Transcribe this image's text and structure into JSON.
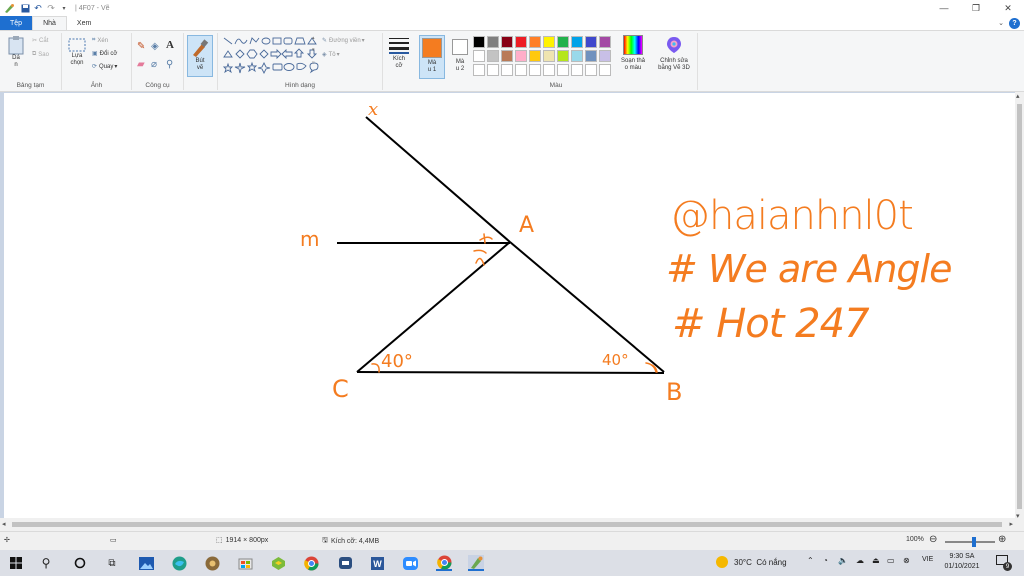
{
  "title_bar": {
    "title": "| 4F07 - Vẽ",
    "controls": [
      "—",
      "❐",
      "✕"
    ]
  },
  "tabs": [
    {
      "label": "Tệp"
    },
    {
      "label": "Nhà"
    },
    {
      "label": "Xem"
    }
  ],
  "ribbon": {
    "clipboard": {
      "paste_label": "Dá\nn",
      "cut_label": "Cắt",
      "copy_label": "Sao",
      "group_label": "Bảng tạm"
    },
    "image": {
      "select_label": "Lựa\nchọn",
      "crop_label": "Xén",
      "resize_label": "Đổi cỡ",
      "rotate_label": "Quay",
      "group_label": "Ảnh"
    },
    "tools": {
      "group_label": "Công cụ"
    },
    "brushes": {
      "label": "Bút\nvẽ"
    },
    "shapes": {
      "outline_label": "Đường viền",
      "fill_label": "Tô",
      "group_label": "Hình dạng"
    },
    "size": {
      "label": "Kích\ncỡ"
    },
    "colors": {
      "color1_label": "Mà\nu 1",
      "color2_label": "Mà\nu 2",
      "edit_label": "Soạn thả\no màu",
      "paint3d_label": "Chỉnh sửa\nbằng Vẽ 3D",
      "group_label": "Màu",
      "color1": "#f47c20",
      "color2": "#ffffff",
      "palette_row1": [
        "#000000",
        "#7f7f7f",
        "#880015",
        "#ed1c24",
        "#ff7f27",
        "#fff200",
        "#22b14c",
        "#00a2e8",
        "#3f48cc",
        "#a349a4"
      ],
      "palette_row2": [
        "#ffffff",
        "#c3c3c3",
        "#b97a57",
        "#ffaec9",
        "#ffc90e",
        "#efe4b0",
        "#b5e61d",
        "#99d9ea",
        "#7092be",
        "#c8bfe7"
      ],
      "palette_row3": [
        "#ffffff",
        "#ffffff",
        "#ffffff",
        "#ffffff",
        "#ffffff",
        "#ffffff",
        "#ffffff",
        "#ffffff",
        "#ffffff",
        "#ffffff"
      ]
    }
  },
  "drawing": {
    "ink_color": "#f47c20",
    "label_x": "x",
    "label_m": "m",
    "label_A": "A",
    "label_B": "B",
    "label_C": "C",
    "angle_C": "40°",
    "angle_B": "40°",
    "note_line1": "@haianhnl0t",
    "note_line2": "# We are Angle",
    "note_line3": "# Hot 247"
  },
  "status_bar": {
    "dimensions": "1914 × 800px",
    "file_size": "Kích cỡ: 4,4MB",
    "zoom": "100%"
  },
  "taskbar": {
    "weather": "30°C  Có nắng",
    "language": "VIE",
    "time": "9:30 SA",
    "date": "01/10/2021",
    "notification_count": "9"
  }
}
